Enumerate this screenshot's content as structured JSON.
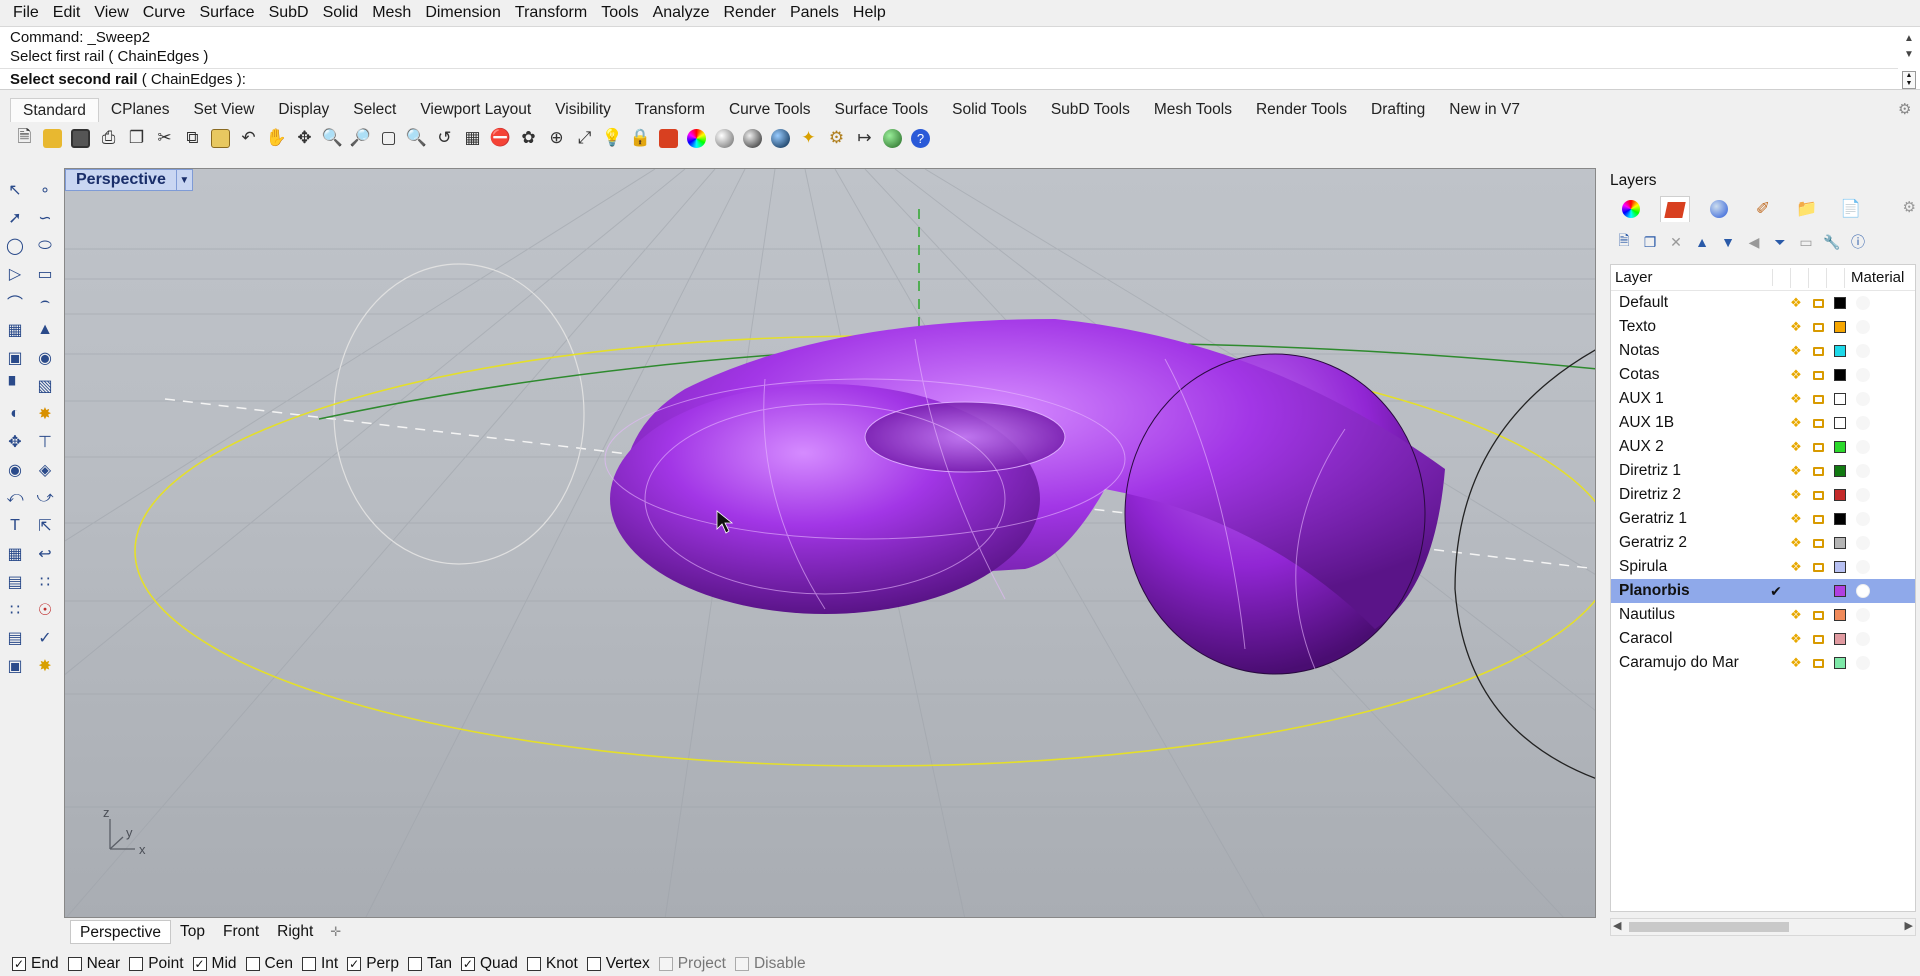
{
  "menu": [
    "File",
    "Edit",
    "View",
    "Curve",
    "Surface",
    "SubD",
    "Solid",
    "Mesh",
    "Dimension",
    "Transform",
    "Tools",
    "Analyze",
    "Render",
    "Panels",
    "Help"
  ],
  "command": {
    "line1": "Command: _Sweep2",
    "line2": "Select first rail ( ChainEdges )",
    "prompt_bold": "Select second rail",
    "prompt_rest": " ( ChainEdges ):"
  },
  "toolbar_tabs": [
    "Standard",
    "CPlanes",
    "Set View",
    "Display",
    "Select",
    "Viewport Layout",
    "Visibility",
    "Transform",
    "Curve Tools",
    "Surface Tools",
    "Solid Tools",
    "SubD Tools",
    "Mesh Tools",
    "Render Tools",
    "Drafting",
    "New in V7"
  ],
  "active_toolbar_tab": "Standard",
  "viewport": {
    "title": "Perspective",
    "axes": {
      "z": "z",
      "y": "y",
      "x": "x"
    },
    "colors": {
      "surface": "#9b32d8",
      "rail1": "#e8e02a",
      "rail2": "#2e8a2e"
    }
  },
  "viewport_tabs": [
    "Perspective",
    "Top",
    "Front",
    "Right"
  ],
  "osnaps": [
    {
      "label": "End",
      "checked": true,
      "enabled": true
    },
    {
      "label": "Near",
      "checked": false,
      "enabled": true
    },
    {
      "label": "Point",
      "checked": false,
      "enabled": true
    },
    {
      "label": "Mid",
      "checked": true,
      "enabled": true
    },
    {
      "label": "Cen",
      "checked": false,
      "enabled": true
    },
    {
      "label": "Int",
      "checked": false,
      "enabled": true
    },
    {
      "label": "Perp",
      "checked": true,
      "enabled": true
    },
    {
      "label": "Tan",
      "checked": false,
      "enabled": true
    },
    {
      "label": "Quad",
      "checked": true,
      "enabled": true
    },
    {
      "label": "Knot",
      "checked": false,
      "enabled": true
    },
    {
      "label": "Vertex",
      "checked": false,
      "enabled": true
    },
    {
      "label": "Project",
      "checked": false,
      "enabled": false
    },
    {
      "label": "Disable",
      "checked": false,
      "enabled": false
    }
  ],
  "layers_panel": {
    "title": "Layers",
    "col_layer": "Layer",
    "col_material": "Material",
    "layers": [
      {
        "name": "Default",
        "color": "#000000",
        "current": false
      },
      {
        "name": "Texto",
        "color": "#f5a500",
        "current": false
      },
      {
        "name": "Notas",
        "color": "#1ed8e8",
        "current": false
      },
      {
        "name": "Cotas",
        "color": "#000000",
        "current": false
      },
      {
        "name": "AUX 1",
        "color": "#ffffff",
        "current": false
      },
      {
        "name": "AUX 1B",
        "color": "#ffffff",
        "current": false
      },
      {
        "name": "AUX 2",
        "color": "#2bd82b",
        "current": false
      },
      {
        "name": "Diretriz 1",
        "color": "#127a12",
        "current": false
      },
      {
        "name": "Diretriz 2",
        "color": "#c42a2a",
        "current": false
      },
      {
        "name": "Geratriz 1",
        "color": "#000000",
        "current": false
      },
      {
        "name": "Geratriz 2",
        "color": "#b4b4b4",
        "current": false
      },
      {
        "name": "Spirula",
        "color": "#b7c0f2",
        "current": false
      },
      {
        "name": "Planorbis",
        "color": "#b040e0",
        "current": true
      },
      {
        "name": "Nautilus",
        "color": "#f08a5a",
        "current": false
      },
      {
        "name": "Caracol",
        "color": "#e09aa0",
        "current": false
      },
      {
        "name": "Caramujo do Mar",
        "color": "#7ee8a8",
        "current": false
      }
    ]
  }
}
